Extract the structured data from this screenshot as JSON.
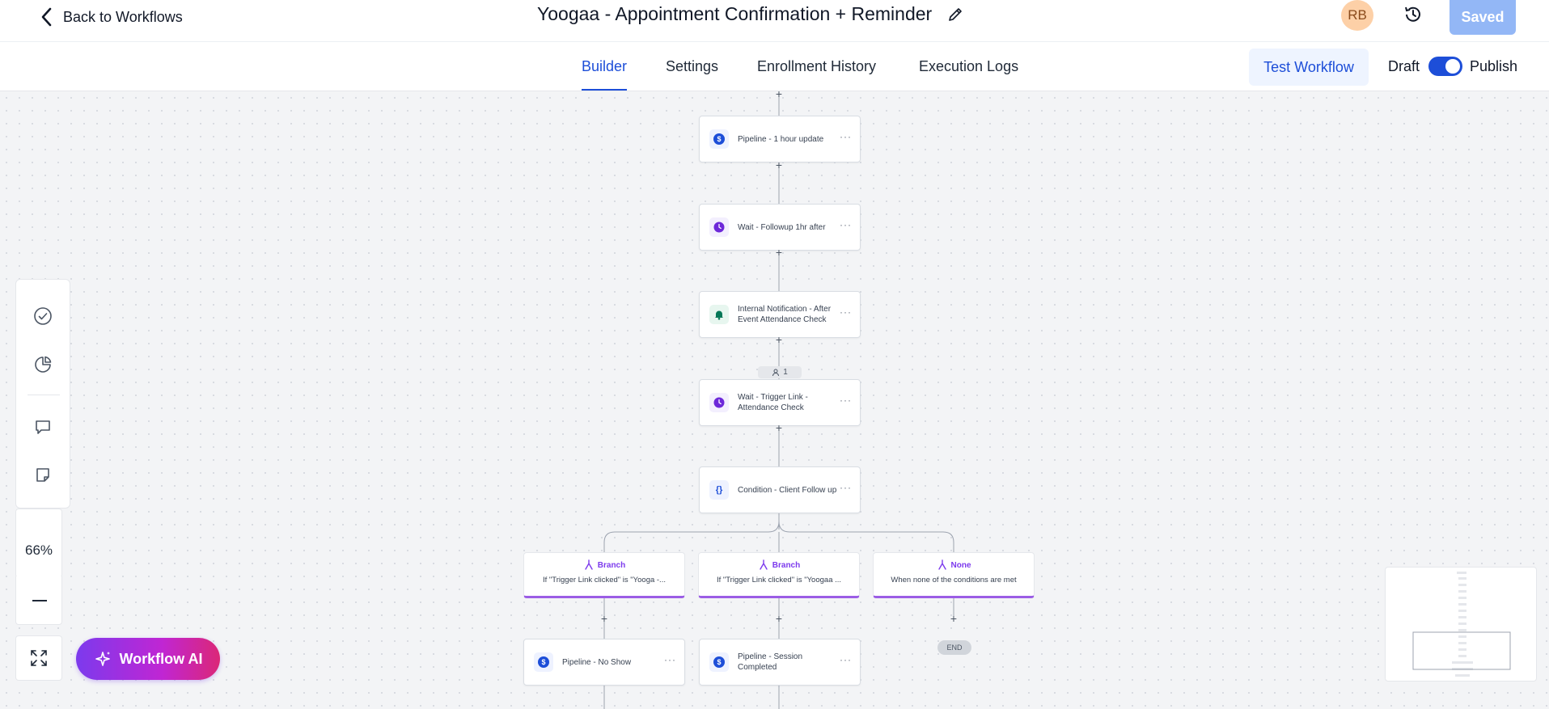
{
  "header": {
    "back_label": "Back to Workflows",
    "title": "Yoogaa - Appointment Confirmation + Reminder",
    "avatar_initials": "RB",
    "saved_label": "Saved"
  },
  "tabs": [
    {
      "label": "Builder",
      "active": true
    },
    {
      "label": "Settings",
      "active": false
    },
    {
      "label": "Enrollment History",
      "active": false
    },
    {
      "label": "Execution Logs",
      "active": false
    }
  ],
  "actions": {
    "test_workflow_label": "Test Workflow",
    "draft_label": "Draft",
    "publish_label": "Publish",
    "publish_toggle_on": true
  },
  "colors": {
    "accent": "#1d4ed8",
    "branch": "#9b5de5",
    "wait": "#6d28d9",
    "notification": "#047857"
  },
  "nodes": [
    {
      "icon": "dollar-icon",
      "icon_glyph": "$",
      "label": "Pipeline - 1 hour update"
    },
    {
      "icon": "clock-icon",
      "icon_glyph": "",
      "label": "Wait - Followup 1hr after"
    },
    {
      "icon": "bell-icon",
      "icon_glyph": "",
      "label": "Internal Notification - After Event Attendance Check"
    },
    {
      "icon": "clock-icon",
      "icon_glyph": "",
      "label": "Wait - Trigger Link - Attendance Check"
    },
    {
      "icon": "braces-icon",
      "icon_glyph": "{}",
      "label": "Condition - Client Follow up"
    }
  ],
  "enrolled_count": "1",
  "branches": [
    {
      "title": "Branch",
      "description": "If \"Trigger Link clicked\" is \"Yooga -..."
    },
    {
      "title": "Branch",
      "description": "If \"Trigger Link clicked\" is \"Yoogaa ..."
    },
    {
      "title": "None",
      "description": "When none of the conditions are met"
    }
  ],
  "branch_nodes": [
    {
      "icon": "dollar-icon",
      "icon_glyph": "$",
      "label": "Pipeline - No Show"
    },
    {
      "icon": "dollar-icon",
      "icon_glyph": "$",
      "label": "Pipeline - Session Completed"
    }
  ],
  "end_label": "END",
  "more_glyph": "···",
  "plus_glyph": "+",
  "zoom_level": "66%",
  "ai_button_label": "Workflow AI"
}
